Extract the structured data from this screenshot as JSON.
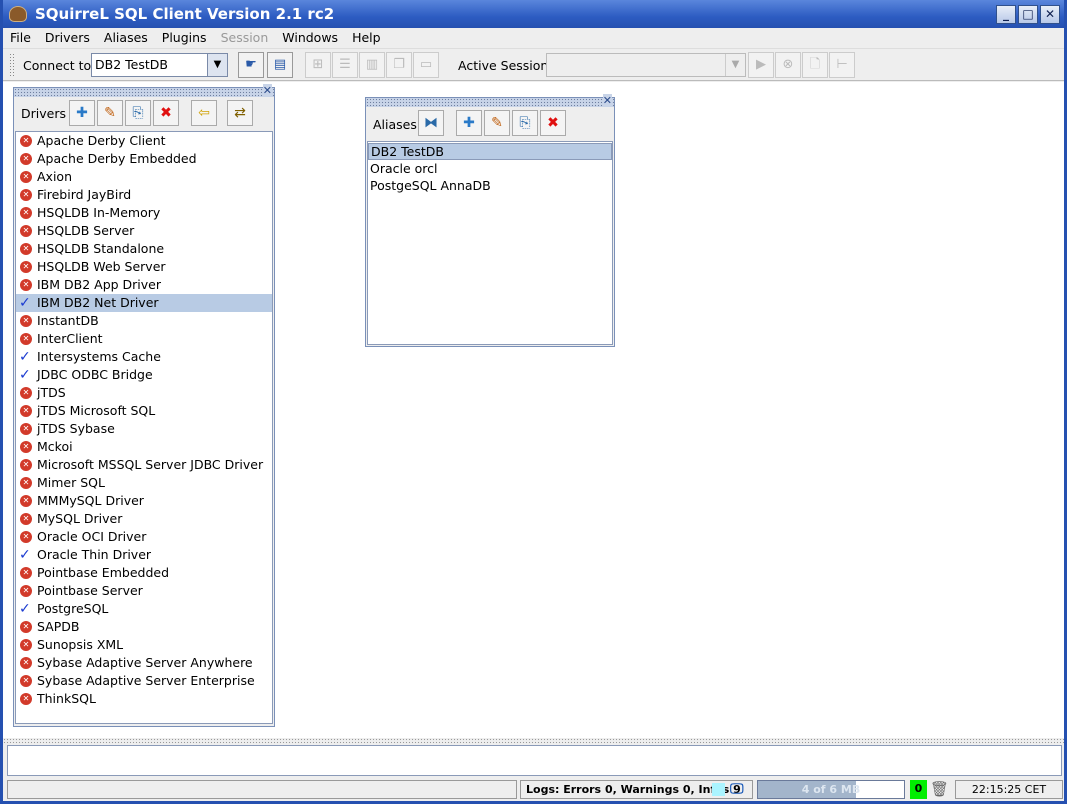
{
  "window": {
    "title": "SQuirreL SQL Client Version 2.1 rc2"
  },
  "menu": [
    "File",
    "Drivers",
    "Aliases",
    "Plugins",
    "Session",
    "Windows",
    "Help"
  ],
  "toolbar": {
    "connect_label": "Connect to:",
    "connect_value": "DB2 TestDB",
    "active_session_label": "Active Session:",
    "active_session_value": ""
  },
  "drivers": {
    "title": "Drivers",
    "items": [
      {
        "name": "Apache Derby Client",
        "ok": false
      },
      {
        "name": "Apache Derby Embedded",
        "ok": false
      },
      {
        "name": "Axion",
        "ok": false
      },
      {
        "name": "Firebird JayBird",
        "ok": false
      },
      {
        "name": "HSQLDB In-Memory",
        "ok": false
      },
      {
        "name": "HSQLDB Server",
        "ok": false
      },
      {
        "name": "HSQLDB Standalone",
        "ok": false
      },
      {
        "name": "HSQLDB Web Server",
        "ok": false
      },
      {
        "name": "IBM DB2 App Driver",
        "ok": false
      },
      {
        "name": "IBM DB2 Net Driver",
        "ok": true,
        "selected": true
      },
      {
        "name": "InstantDB",
        "ok": false
      },
      {
        "name": "InterClient",
        "ok": false
      },
      {
        "name": "Intersystems Cache",
        "ok": true
      },
      {
        "name": "JDBC ODBC Bridge",
        "ok": true
      },
      {
        "name": "jTDS",
        "ok": false
      },
      {
        "name": "jTDS Microsoft SQL",
        "ok": false
      },
      {
        "name": "jTDS Sybase",
        "ok": false
      },
      {
        "name": "Mckoi",
        "ok": false
      },
      {
        "name": "Microsoft MSSQL Server JDBC Driver",
        "ok": false
      },
      {
        "name": "Mimer SQL",
        "ok": false
      },
      {
        "name": "MMMySQL Driver",
        "ok": false
      },
      {
        "name": "MySQL Driver",
        "ok": false
      },
      {
        "name": "Oracle OCI Driver",
        "ok": false
      },
      {
        "name": "Oracle Thin Driver",
        "ok": true
      },
      {
        "name": "Pointbase Embedded",
        "ok": false
      },
      {
        "name": "Pointbase Server",
        "ok": false
      },
      {
        "name": "PostgreSQL",
        "ok": true
      },
      {
        "name": "SAPDB",
        "ok": false
      },
      {
        "name": "Sunopsis XML",
        "ok": false
      },
      {
        "name": "Sybase Adaptive Server Anywhere",
        "ok": false
      },
      {
        "name": "Sybase Adaptive Server Enterprise",
        "ok": false
      },
      {
        "name": "ThinkSQL",
        "ok": false
      }
    ]
  },
  "aliases": {
    "title": "Aliases",
    "items": [
      "DB2 TestDB",
      "Oracle orcl",
      "PostgeSQL AnnaDB"
    ],
    "selected": 0
  },
  "status": {
    "logs": "Logs: Errors 0, Warnings 0, Infos 9",
    "memory": "4 of 6 MB",
    "memory_fraction": 0.67,
    "sessions": "0",
    "clock": "22:15:25 CET"
  },
  "colors": {
    "title_bar": "#2d5cc2",
    "selection": "#b8cbe4",
    "error_icon": "#d23a2a",
    "check": "#1a3ad0",
    "session_count_bg": "#00ee00"
  }
}
